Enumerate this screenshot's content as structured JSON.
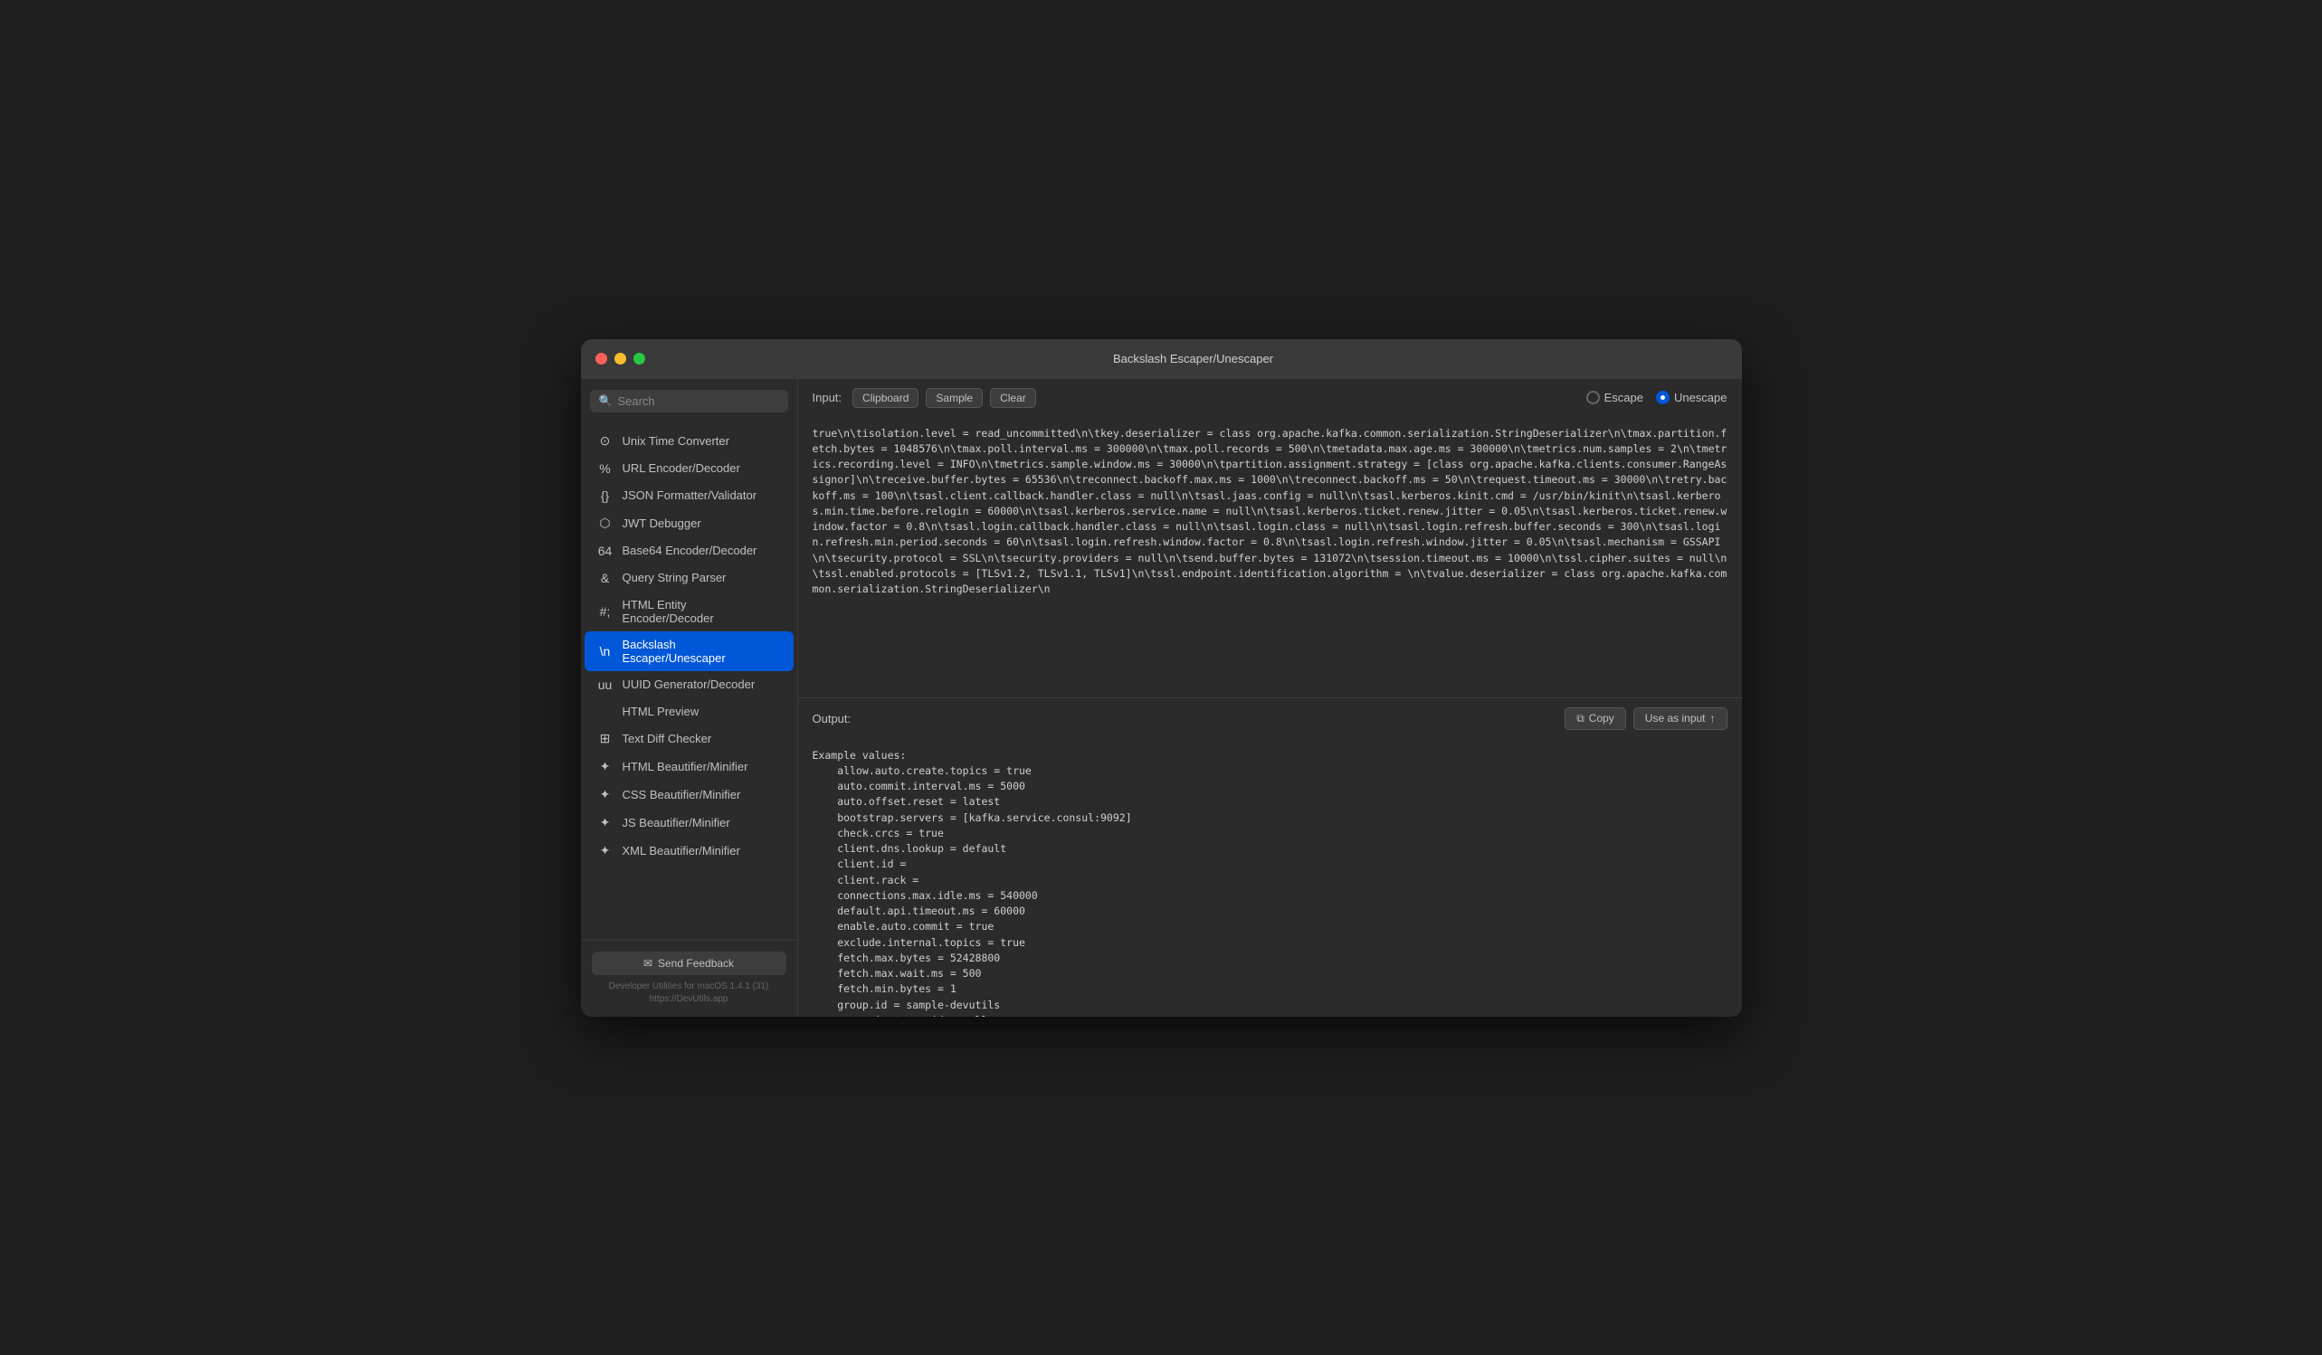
{
  "window": {
    "title": "Backslash Escaper/Unescaper"
  },
  "sidebar": {
    "search_placeholder": "Search",
    "items": [
      {
        "id": "unix-time",
        "icon": "⊙",
        "label": "Unix Time Converter",
        "active": false
      },
      {
        "id": "url-encoder",
        "icon": "%",
        "label": "URL Encoder/Decoder",
        "active": false
      },
      {
        "id": "json-formatter",
        "icon": "{}",
        "label": "JSON Formatter/Validator",
        "active": false
      },
      {
        "id": "jwt-debugger",
        "icon": "⬡",
        "label": "JWT Debugger",
        "active": false
      },
      {
        "id": "base64",
        "icon": "64",
        "label": "Base64 Encoder/Decoder",
        "active": false
      },
      {
        "id": "query-string",
        "icon": "&",
        "label": "Query String Parser",
        "active": false
      },
      {
        "id": "html-entity",
        "icon": "#;",
        "label": "HTML Entity Encoder/Decoder",
        "active": false
      },
      {
        "id": "backslash",
        "icon": "\\n",
        "label": "Backslash Escaper/Unescaper",
        "active": true
      },
      {
        "id": "uuid",
        "icon": "uu",
        "label": "UUID Generator/Decoder",
        "active": false
      },
      {
        "id": "html-preview",
        "icon": "</>",
        "label": "HTML Preview",
        "active": false
      },
      {
        "id": "text-diff",
        "icon": "⊞",
        "label": "Text Diff Checker",
        "active": false
      },
      {
        "id": "html-beautifier",
        "icon": "✦",
        "label": "HTML Beautifier/Minifier",
        "active": false
      },
      {
        "id": "css-beautifier",
        "icon": "✦",
        "label": "CSS Beautifier/Minifier",
        "active": false
      },
      {
        "id": "js-beautifier",
        "icon": "✦",
        "label": "JS Beautifier/Minifier",
        "active": false
      },
      {
        "id": "xml-beautifier",
        "icon": "✦",
        "label": "XML Beautifier/Minifier",
        "active": false
      }
    ],
    "feedback_button": "Send Feedback",
    "footer_version": "Developer Utilities for macOS 1.4.1 (31)",
    "footer_url": "https://DevUtils.app"
  },
  "input": {
    "label": "Input:",
    "clipboard_btn": "Clipboard",
    "sample_btn": "Sample",
    "clear_btn": "Clear",
    "escape_label": "Escape",
    "unescape_label": "Unescape",
    "escape_selected": false,
    "unescape_selected": true,
    "content": "true\\n\\tisolation.level = read_uncommitted\\n\\tkey.deserializer = class org.apache.kafka.common.serialization.StringDeserializer\\n\\tmax.partition.fetch.bytes = 1048576\\n\\tmax.poll.interval.ms = 300000\\n\\tmax.poll.records = 500\\n\\tmetadata.max.age.ms = 300000\\n\\tmetrics.num.samples = 2\\n\\tmetrics.recording.level = INFO\\n\\tmetrics.sample.window.ms = 30000\\n\\tpartition.assignment.strategy = [class org.apache.kafka.clients.consumer.RangeAssignor]\\n\\treceive.buffer.bytes = 65536\\n\\treconnect.backoff.max.ms = 1000\\n\\treconnect.backoff.ms = 50\\n\\trequest.timeout.ms = 30000\\n\\tretry.backoff.ms = 100\\n\\tsasl.client.callback.handler.class = null\\n\\tsasl.jaas.config = null\\n\\tsasl.kerberos.kinit.cmd = /usr/bin/kinit\\n\\tsasl.kerberos.min.time.before.relogin = 60000\\n\\tsasl.kerberos.service.name = null\\n\\tsasl.kerberos.ticket.renew.jitter = 0.05\\n\\tsasl.kerberos.ticket.renew.window.factor = 0.8\\n\\tsasl.login.callback.handler.class = null\\n\\tsasl.login.class = null\\n\\tsasl.login.refresh.buffer.seconds = 300\\n\\tsasl.login.refresh.min.period.seconds = 60\\n\\tsasl.login.refresh.window.factor = 0.8\\n\\tsasl.login.refresh.window.jitter = 0.05\\n\\tsasl.mechanism = GSSAPI\\n\\tsecurity.protocol = SSL\\n\\tsecurity.providers = null\\n\\tsend.buffer.bytes = 131072\\n\\tsession.timeout.ms = 10000\\n\\tssl.cipher.suites = null\\n\\tssl.enabled.protocols = [TLSv1.2, TLSv1.1, TLSv1]\\n\\tssl.endpoint.identification.algorithm = \\n\\tvalue.deserializer = class org.apache.kafka.common.serialization.StringDeserializer\\n"
  },
  "output": {
    "label": "Output:",
    "copy_btn": "Copy",
    "use_as_input_btn": "Use as input",
    "content": "Example values:\n    allow.auto.create.topics = true\n    auto.commit.interval.ms = 5000\n    auto.offset.reset = latest\n    bootstrap.servers = [kafka.service.consul:9092]\n    check.crcs = true\n    client.dns.lookup = default\n    client.id =\n    client.rack =\n    connections.max.idle.ms = 540000\n    default.api.timeout.ms = 60000\n    enable.auto.commit = true\n    exclude.internal.topics = true\n    fetch.max.bytes = 52428800\n    fetch.max.wait.ms = 500\n    fetch.min.bytes = 1\n    group.id = sample-devutils\n    group.instance.id = null"
  },
  "colors": {
    "active_bg": "#0057d8",
    "window_bg": "#2b2b2b",
    "sidebar_bg": "#2b2b2b",
    "text_primary": "#d0d0d0",
    "text_secondary": "#888888",
    "border": "#3a3a3a"
  }
}
